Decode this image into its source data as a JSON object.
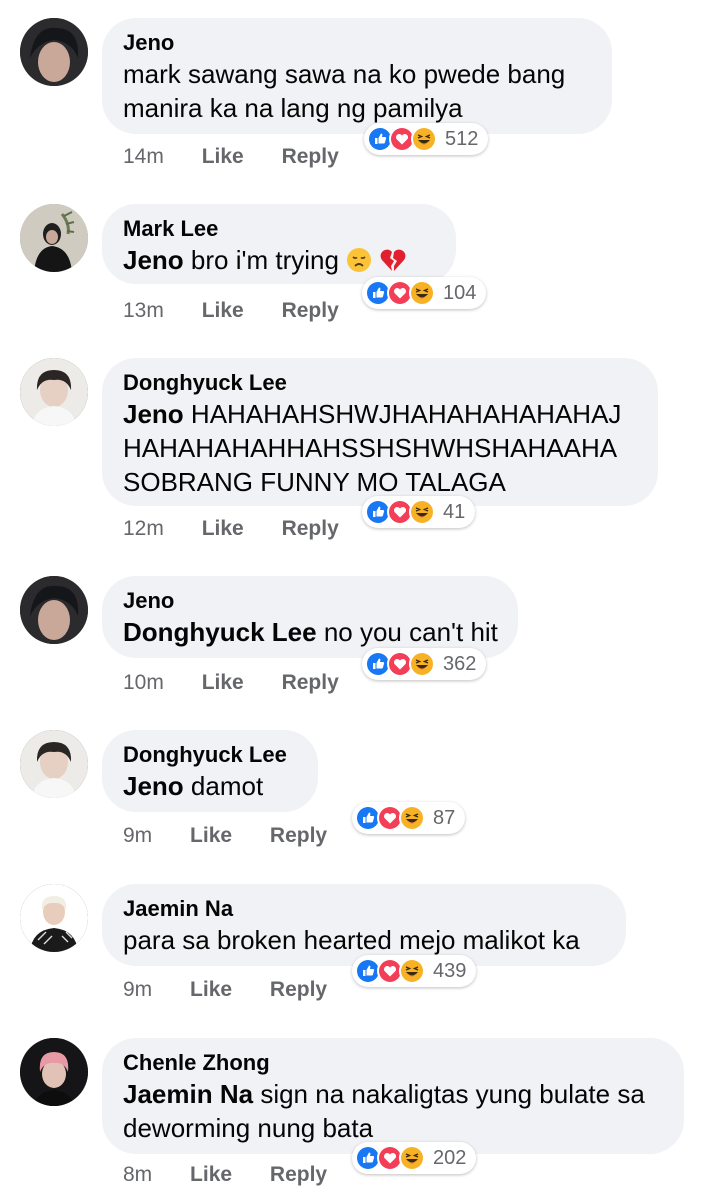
{
  "comments": [
    {
      "author": "Jeno",
      "mention": "",
      "lines": [
        "mark sawang sawa na ko pwede bang",
        "manira ka na lang ng pamilya"
      ],
      "time": "14m",
      "like": "Like",
      "reply": "Reply",
      "reaction_icons": [
        "like-reaction-icon",
        "love-reaction-icon",
        "haha-reaction-icon"
      ],
      "reaction_count": "512"
    },
    {
      "author": "Mark Lee",
      "mention": "Jeno",
      "lines": [
        "bro i'm trying"
      ],
      "emojis": [
        "disappointed-face-emoji",
        "broken-heart-emoji"
      ],
      "time": "13m",
      "like": "Like",
      "reply": "Reply",
      "reaction_count": "104"
    },
    {
      "author": "Donghyuck Lee",
      "mention": "Jeno",
      "lines": [
        "HAHAHAHSHWJHAHAHAHAHAHAJ",
        "HAHAHAHAHHAHSSHSHWHSHAHAAHA",
        "SOBRANG FUNNY MO TALAGA"
      ],
      "time": "12m",
      "like": "Like",
      "reply": "Reply",
      "reaction_count": "41"
    },
    {
      "author": "Jeno",
      "mention": "Donghyuck Lee",
      "lines": [
        "no you can't hit"
      ],
      "time": "10m",
      "like": "Like",
      "reply": "Reply",
      "reaction_count": "362"
    },
    {
      "author": "Donghyuck Lee",
      "mention": "Jeno",
      "lines": [
        "damot"
      ],
      "time": "9m",
      "like": "Like",
      "reply": "Reply",
      "reaction_count": "87"
    },
    {
      "author": "Jaemin Na",
      "mention": "",
      "lines": [
        "para sa broken hearted mejo malikot ka"
      ],
      "time": "9m",
      "like": "Like",
      "reply": "Reply",
      "reaction_count": "439"
    },
    {
      "author": "Chenle Zhong",
      "mention": "Jaemin Na",
      "lines": [
        "sign na nakaligtas yung bulate sa",
        "deworming nung bata"
      ],
      "time": "8m",
      "like": "Like",
      "reply": "Reply",
      "reaction_count": "202"
    }
  ],
  "colors": {
    "bubble": "#f0f2f5",
    "meta": "#65676b",
    "like_blue": "#1877f2",
    "love_red": "#f33e58",
    "haha_yellow": "#f7b125"
  }
}
